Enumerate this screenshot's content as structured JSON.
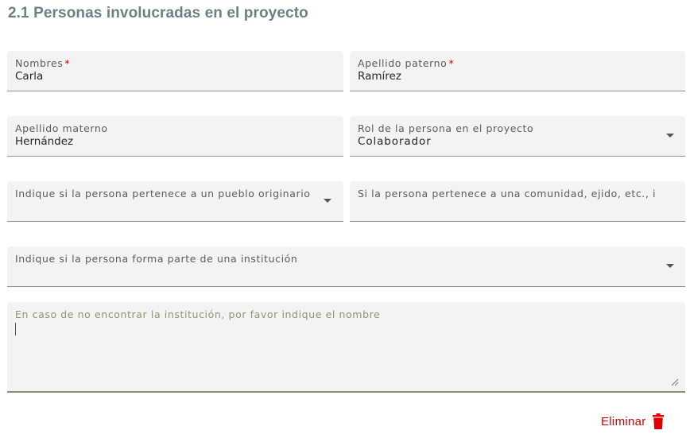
{
  "section": {
    "title": "2.1 Personas involucradas en el proyecto"
  },
  "fields": {
    "nombres": {
      "label": "Nombres",
      "required_mark": "*",
      "value": "Carla"
    },
    "apellido_paterno": {
      "label": "Apellido paterno",
      "required_mark": "*",
      "value": "Ramírez"
    },
    "apellido_materno": {
      "label": "Apellido materno",
      "value": "Hernández"
    },
    "rol": {
      "label": "Rol de la persona en el proyecto",
      "value": "Colaborador"
    },
    "pueblo_originario": {
      "label": "Indique si la persona pertenece a un pueblo originario",
      "value": ""
    },
    "comunidad": {
      "label": "Si la persona pertenece a una comunidad, ejido, etc., i",
      "value": ""
    },
    "institucion": {
      "label": "Indique si la persona forma parte de una institución",
      "value": ""
    },
    "institucion_nombre": {
      "label": "En caso de no encontrar la institución, por favor indique el nombre",
      "value": ""
    }
  },
  "actions": {
    "delete_label": "Eliminar"
  },
  "colors": {
    "title": "#6b7f86",
    "field_bg": "#f3f3f3",
    "required": "#d40000",
    "delete": "#d10000",
    "focus_underline": "#8d8f6e"
  },
  "icons": {
    "dropdown": "chevron-down-icon",
    "delete": "trash-icon",
    "resize": "resize-handle-icon"
  }
}
